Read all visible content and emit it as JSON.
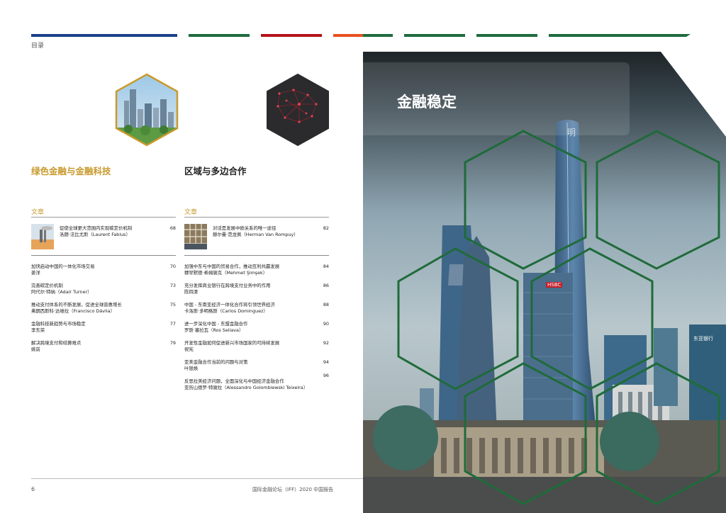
{
  "header": {
    "toc_label": "目录",
    "bar_colors": [
      "#1b3f8b",
      "#1e6b3f",
      "#b5121b",
      "#e8501e",
      "#1e6b3f"
    ]
  },
  "sections": {
    "green_title": "绿色金融与金融科技",
    "regional_title": "区域与多边合作",
    "green_color": "#c99a2e",
    "hex_border_color": "#c99a2e"
  },
  "left_column": {
    "heading": "文章",
    "entries": [
      {
        "title": "促使全球更大范围内实现碳定价机制",
        "author": "洛朗·法比尤斯（Laurent Fabius）",
        "page": "68"
      },
      {
        "title": "加快启动中国的一体化市场交易",
        "author": "姜洋",
        "page": "70"
      },
      {
        "title": "完善碳定价机制",
        "author": "阿代尔·特纳（Adair Turner）",
        "page": "73"
      },
      {
        "title": "推动支付体系的不断发展，促进全球普惠增长",
        "author": "弗朗西斯科·达维拉（Francisco Dávila）",
        "page": "75"
      },
      {
        "title": "金融科技新趋势与市场稳定",
        "author": "李东荣",
        "page": "77"
      },
      {
        "title": "解决跨境支付和结算难点",
        "author": "姚前",
        "page": "79"
      }
    ]
  },
  "right_column": {
    "heading": "文章",
    "entries": [
      {
        "title": "对话是发展中欧关系的唯一途径",
        "author": "赫尔曼·范龙佩（Herman Van Rompuy）",
        "page": "82"
      },
      {
        "title": "加强中东与中国的贸易合作，推动互利共赢发展",
        "author": "穆罕默德·希姆谢克（Mehmet Şimşek）",
        "page": "84"
      },
      {
        "title": "充分发挥商业银行在跨境支付业务中的作用",
        "author": "陈四清",
        "page": "86"
      },
      {
        "title": "中国 - 东南亚经济一体化合作将引领世界经济",
        "author": "卡洛斯·多明格斯（Carlos Dominguez）",
        "page": "88"
      },
      {
        "title": "进一步深化中国 - 东盟金融合作",
        "author": "罗斯·塞拉瓦（Ros Seilava）",
        "page": "90"
      },
      {
        "title": "开发性金融如何促进新兴市场国家的可持续发展",
        "author": "祝宪",
        "page": "92"
      },
      {
        "title": "亚美金融合作当前的问题与对策",
        "author": "叶银焕",
        "page": "94"
      },
      {
        "title": "",
        "author": "",
        "page": "96"
      },
      {
        "title": "反思拉美经济问题，全面深化与中国经济金融合作",
        "author": "亚历山德罗·特谢拉（Alessandro Golombiewski Teixeira）",
        "page": ""
      }
    ]
  },
  "footer": {
    "page_number": "6",
    "report_title": "国际金融论坛（IFF）2020 中国报告"
  },
  "photo_panel": {
    "title": "金融稳定",
    "hex_color": "#1f6b3a",
    "sign_1": "HSBC",
    "sign_2": "东亚银行",
    "sign_3": "明"
  }
}
